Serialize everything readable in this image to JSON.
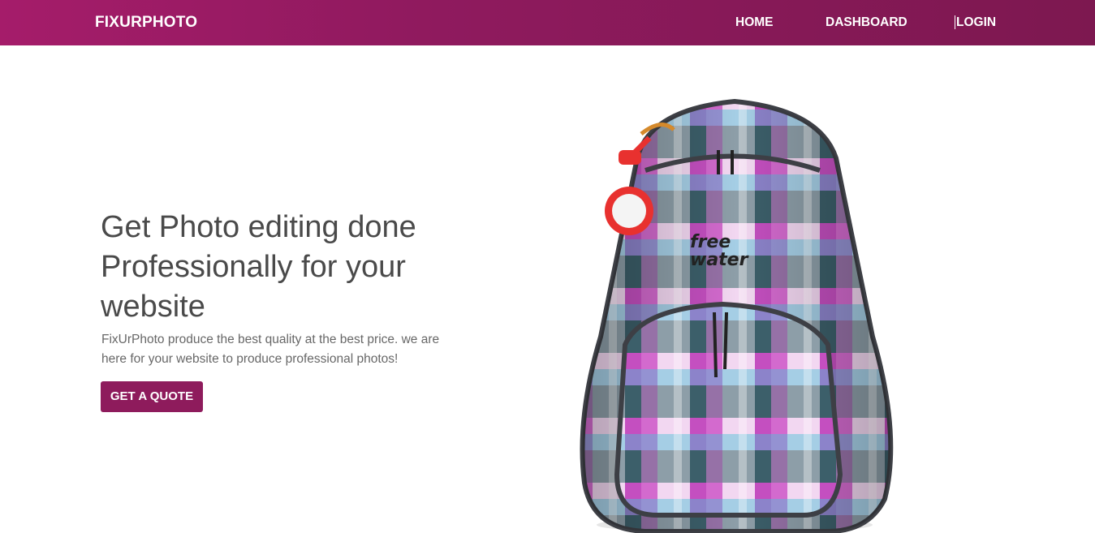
{
  "navbar": {
    "brand": "FIXURPHOTO",
    "links": [
      {
        "label": "HOME"
      },
      {
        "label": "DASHBOARD"
      },
      {
        "label": "LOGIN"
      }
    ]
  },
  "hero": {
    "heading": "Get Photo editing done Professionally for your website",
    "description": "FixUrPhoto produce the best quality at the best price. we are here for your website to produce professional photos!",
    "cta_label": "GET A QUOTE"
  },
  "product_image": {
    "icon": "backpack-image",
    "logo_text": "free water"
  },
  "colors": {
    "brand": "#8e1b5c",
    "heading": "#4a4a4a",
    "body_text": "#676767"
  }
}
